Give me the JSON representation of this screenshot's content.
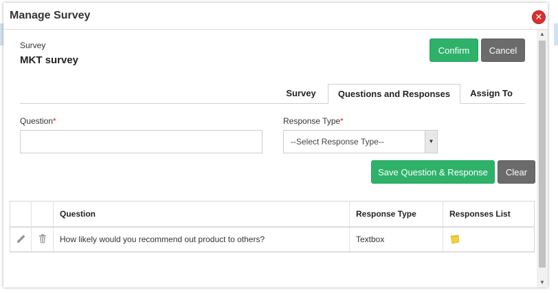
{
  "dialog": {
    "title": "Manage Survey",
    "close_icon": "close-icon",
    "close_glyph": "✕"
  },
  "survey": {
    "label": "Survey",
    "name": "MKT survey"
  },
  "actions": {
    "confirm_label": "Confirm",
    "cancel_label": "Cancel",
    "save_label": "Save Question & Response",
    "clear_label": "Clear"
  },
  "tabs": [
    {
      "label": "Survey",
      "active": false
    },
    {
      "label": "Questions and Responses",
      "active": true
    },
    {
      "label": "Assign To",
      "active": false
    }
  ],
  "form": {
    "question_label": "Question",
    "response_type_label": "Response Type",
    "required_marker": "*",
    "question_value": "",
    "response_type_selected": "--Select Response Type--"
  },
  "table": {
    "columns": [
      "",
      "",
      "Question",
      "Response Type",
      "Responses List"
    ],
    "rows": [
      {
        "question": "How likely would you recommend out product to others?",
        "response_type": "Textbox",
        "icons": [
          "pencil-icon",
          "trash-icon",
          "note-icon"
        ]
      }
    ]
  },
  "colors": {
    "confirm": "#2eb26a",
    "cancel": "#6b6b6b",
    "close": "#d9302e",
    "required": "#e02020"
  }
}
